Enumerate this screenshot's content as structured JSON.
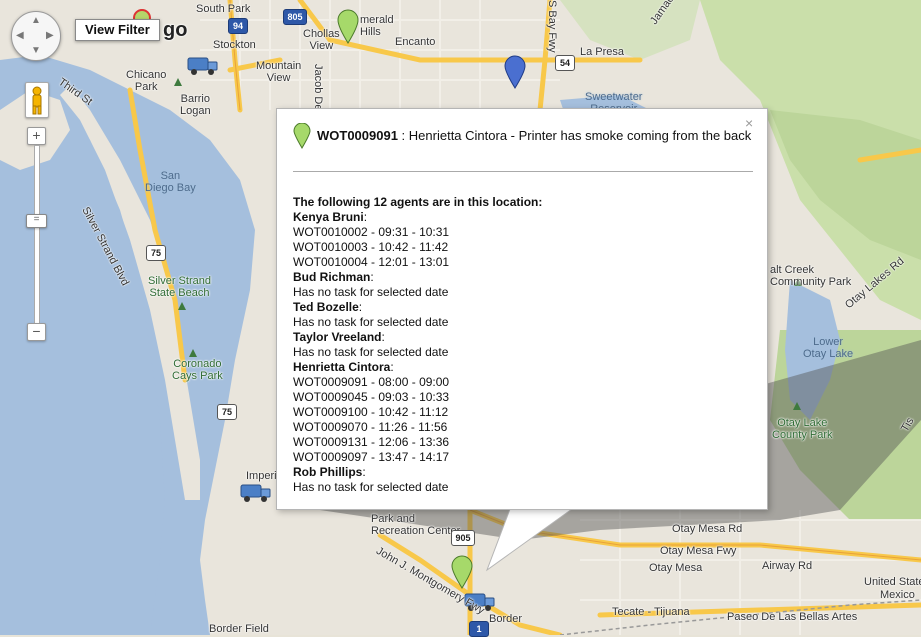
{
  "map": {
    "labels": {
      "south_park": "South Park",
      "san_diego_partial": "go",
      "chollas_view": "Chollas\nView",
      "emerald_hills": "Emerald\nHills",
      "encanto": "Encanto",
      "stockton": "Stockton",
      "mountain_view": "Mountain\nView",
      "la_presa": "La Presa",
      "chicano_park": "Chicano\nPark",
      "barrio_logan": "Barrio\nLogan",
      "third_st": "Third St",
      "san_diego_bay": "San\nDiego Bay",
      "silver_strand_blvd": "Silver Strand Blvd",
      "sweetwater_reservoir": "Sweetwater\nReservoir",
      "jamacha_blvd": "Jamacha Blvd",
      "s_bay_fwy": "S Bay Fwy",
      "jacob_dekema": "Jacob De",
      "silver_strand_state_beach": "Silver Strand\nState Beach",
      "coronado_cays_park": "Coronado\nCays Park",
      "salt_creek": "alt Creek\nCommunity Park",
      "otay_lakes_rd": "Otay Lakes Rd",
      "lower_otay_lake": "Lower\nOtay Lake",
      "otay_lake_county_park": "Otay Lake\nCounty Park",
      "imperial_partial": "Imperi",
      "park_rec": "Park and\nRecreation Center",
      "otay_mesa_rd": "Otay Mesa Rd",
      "otay_mesa_fwy": "Otay Mesa Fwy",
      "otay_mesa": "Otay Mesa",
      "airway_rd": "Airway Rd",
      "john_j_montgomery": "John J. Montgomery Fwy",
      "border": "Border",
      "tecate_tijuana": "Tecate - Tijuana",
      "paseo_de_las_bellas_artes": "Paseo De Las Bellas Artes",
      "united_states": "United State",
      "mexico": "Mexico",
      "border_field": "Border Field",
      "tis": "Tis"
    },
    "shields": {
      "s94": "94",
      "s805": "805",
      "s54": "54",
      "s75a": "75",
      "s75b": "75",
      "s905": "905",
      "s1": "1"
    }
  },
  "controls": {
    "pan_label": "pan",
    "zoom_in": "+",
    "zoom_out": "−",
    "zoom_knob": "=",
    "view_filter": "View Filter"
  },
  "infowindow": {
    "close": "×",
    "work_order": "WOT0009091",
    "separator": " : ",
    "description": "Henrietta Cintora - Printer has smoke coming from the back",
    "agents_title": "The following 12 agents are in this location:",
    "agents": [
      {
        "name": "Kenya Bruni",
        "tasks": [
          "WOT0010002 - 09:31 - 10:31",
          "WOT0010003 - 10:42 - 11:42",
          "WOT0010004 - 12:01 - 13:01"
        ]
      },
      {
        "name": "Bud Richman",
        "tasks": [
          "Has no task for selected date"
        ]
      },
      {
        "name": "Ted Bozelle",
        "tasks": [
          "Has no task for selected date"
        ]
      },
      {
        "name": "Taylor Vreeland",
        "tasks": [
          "Has no task for selected date"
        ]
      },
      {
        "name": "Henrietta Cintora",
        "tasks": [
          "WOT0009091 - 08:00 - 09:00",
          "WOT0009045 - 09:03 - 10:33",
          "WOT0009100 - 10:42 - 11:12",
          "WOT0009070 - 11:26 - 11:56",
          "WOT0009131 - 12:06 - 13:36",
          "WOT0009097 - 13:47 - 14:17"
        ]
      },
      {
        "name": "Rob Phillips",
        "tasks": [
          "Has no task for selected date"
        ]
      }
    ]
  },
  "colors": {
    "water": "#a5bfdd",
    "land": "#e9e5dc",
    "park": "#cadfaa",
    "highway": "#f8c84a",
    "pin_green": "#a6d96a",
    "pin_blue": "#4a6fd0"
  }
}
